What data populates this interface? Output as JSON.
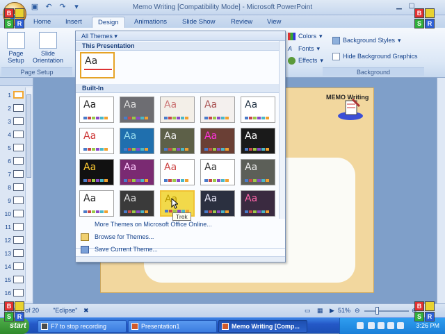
{
  "window": {
    "title": "Memo Writing [Compatibility Mode] - Microsoft PowerPoint"
  },
  "tabs": [
    "Home",
    "Insert",
    "Design",
    "Animations",
    "Slide Show",
    "Review",
    "View"
  ],
  "active_tab": "Design",
  "ribbon": {
    "page_setup": "Page Setup",
    "slide_orientation": "Slide Orientation",
    "page_setup_group": "Page Setup",
    "colors": "Colors",
    "fonts": "Fonts",
    "effects": "Effects",
    "background_styles": "Background Styles",
    "hide_background_graphics": "Hide Background Graphics",
    "background_group": "Background"
  },
  "gallery": {
    "header": "All Themes",
    "section_this": "This Presentation",
    "section_builtin": "Built-In",
    "tooltip": "Trek",
    "aa": "Aa",
    "menu": [
      "More Themes on Microsoft Office Online...",
      "Browse for Themes...",
      "Save Current Theme..."
    ]
  },
  "slides": [
    "1",
    "2",
    "3",
    "4",
    "5",
    "6",
    "7",
    "8",
    "9",
    "10",
    "11",
    "12",
    "13",
    "14",
    "15",
    "16"
  ],
  "slide": {
    "title": "MEMO Writing"
  },
  "statusbar": {
    "slide_info": "Slide 1 of 20",
    "theme": "\"Eclipse\"",
    "zoom": "51%"
  },
  "taskbar": {
    "start": "start",
    "items": [
      "F7 to stop recording",
      "Presentation1",
      "Memo Writing [Comp..."
    ],
    "clock": "3:26 PM"
  },
  "colors": {
    "ribbon": "#dbe7f6",
    "accent": "#15428b",
    "selected_border": "#e6a325"
  }
}
